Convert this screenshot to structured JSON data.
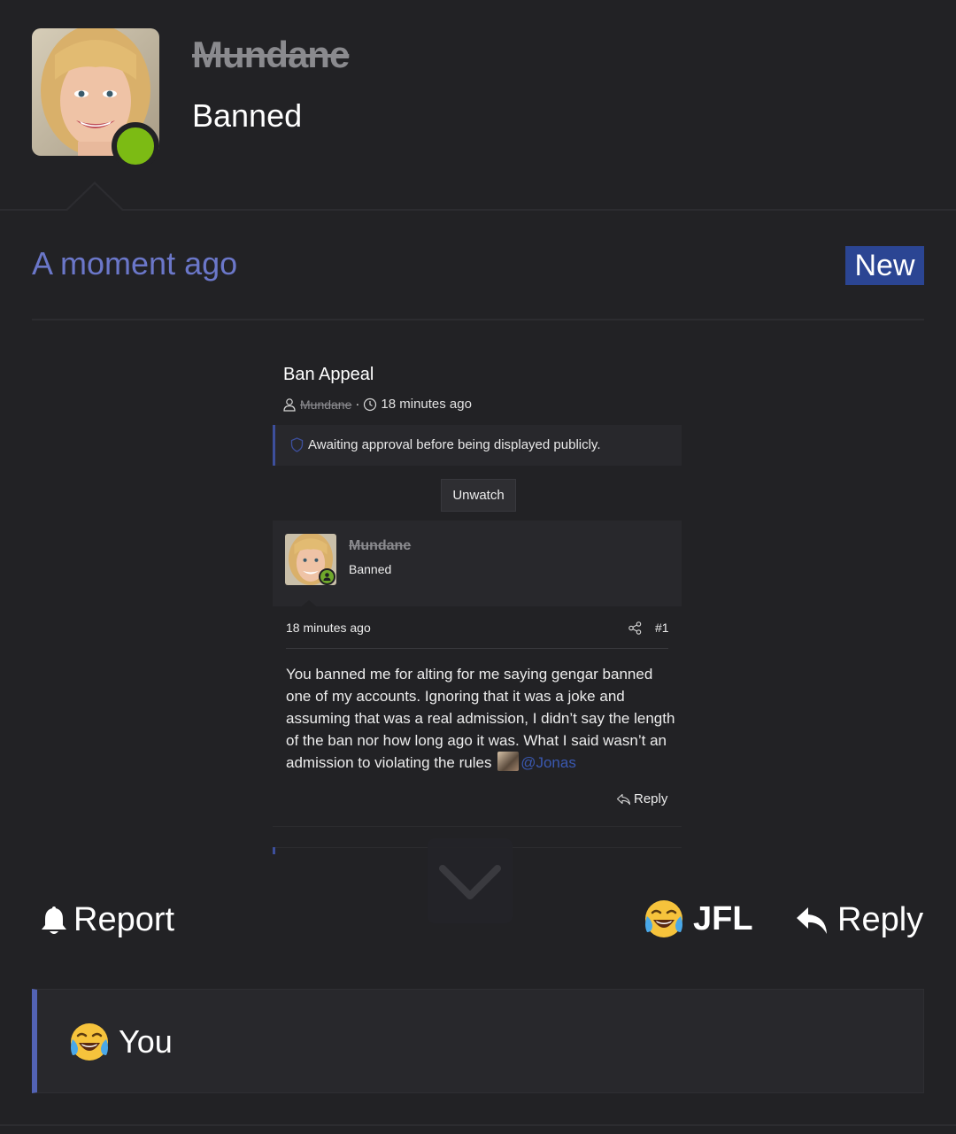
{
  "profile": {
    "username": "Mundane",
    "user_title": "Banned"
  },
  "message": {
    "time": "A moment ago",
    "badge": "New"
  },
  "embed": {
    "thread_title": "Ban Appeal",
    "author": "Mundane",
    "separator": "·",
    "time": "18 minutes ago",
    "approval_notice": "Awaiting approval before being displayed publicly.",
    "unwatch_label": "Unwatch",
    "post": {
      "username": "Mundane",
      "user_title": "Banned",
      "time": "18 minutes ago",
      "post_number": "#1",
      "body": "You banned me for alting for me saying gengar banned one of my accounts. Ignoring that it was a joke and assuming that was a real admission, I didn’t say the length of the ban nor how long ago it was. What I said wasn’t an admission to violating the rules",
      "mention": "@Jonas",
      "reply_label": "Reply"
    }
  },
  "actions": {
    "report_label": "Report",
    "reaction_label": "JFL",
    "reply_label": "Reply"
  },
  "reactions": {
    "summary": "You"
  },
  "icons": {
    "report": "bell-icon",
    "reaction": "laughing-crying-emoji-icon",
    "reply": "reply-arrow-icon",
    "scroll": "chevron-down-icon"
  },
  "colors": {
    "accent": "#6b77c9",
    "badge": "#2b4593",
    "online": "#7cbb14",
    "mention": "#3a58b0"
  }
}
